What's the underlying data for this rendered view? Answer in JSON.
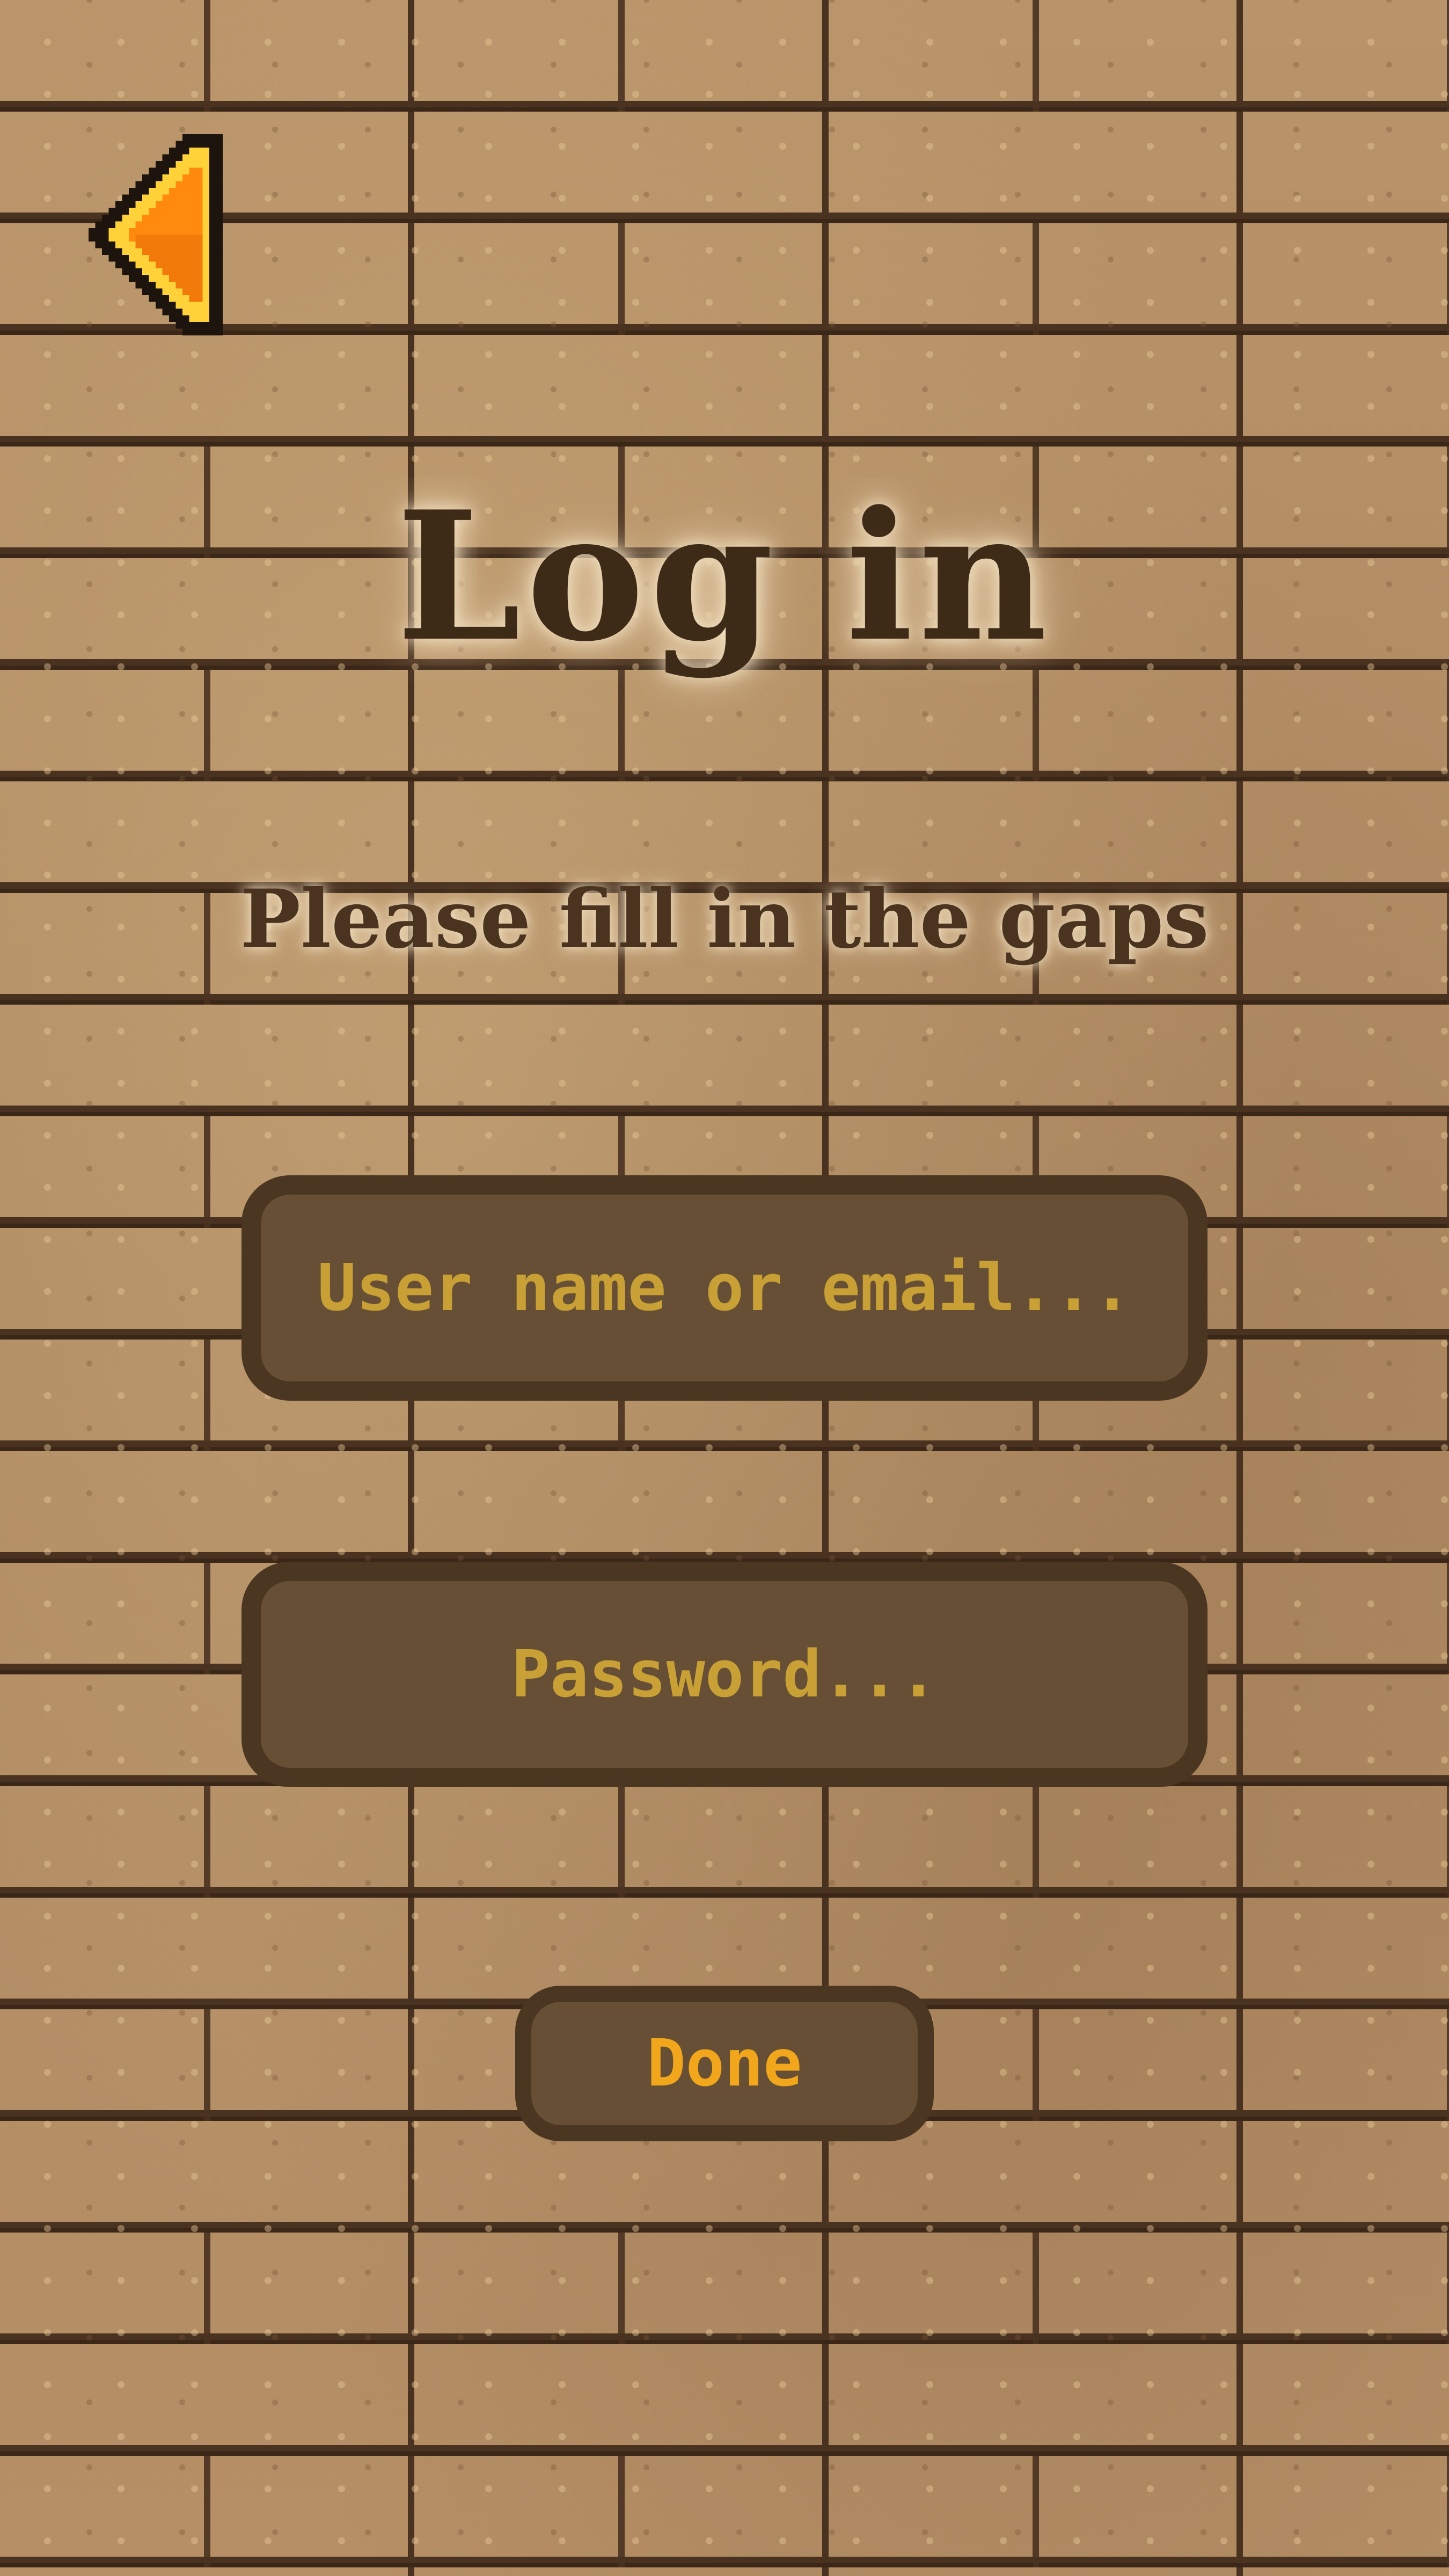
{
  "header": {
    "back_icon": "back-arrow-icon",
    "back_colors": {
      "fill": "#ff8a0d",
      "highlight": "#ffd23a",
      "outline": "#1d140d"
    }
  },
  "title": "Log in",
  "subtitle": "Please fill in the gaps",
  "form": {
    "username": {
      "value": "",
      "placeholder": "User name or email..."
    },
    "password": {
      "value": "",
      "placeholder": "Password..."
    },
    "done_label": "Done"
  },
  "colors": {
    "field_fill": "#664f35",
    "field_border": "#4a3621",
    "placeholder_text": "#c8a035",
    "button_text": "#f2a61c",
    "title_text": "#3d2a17"
  }
}
